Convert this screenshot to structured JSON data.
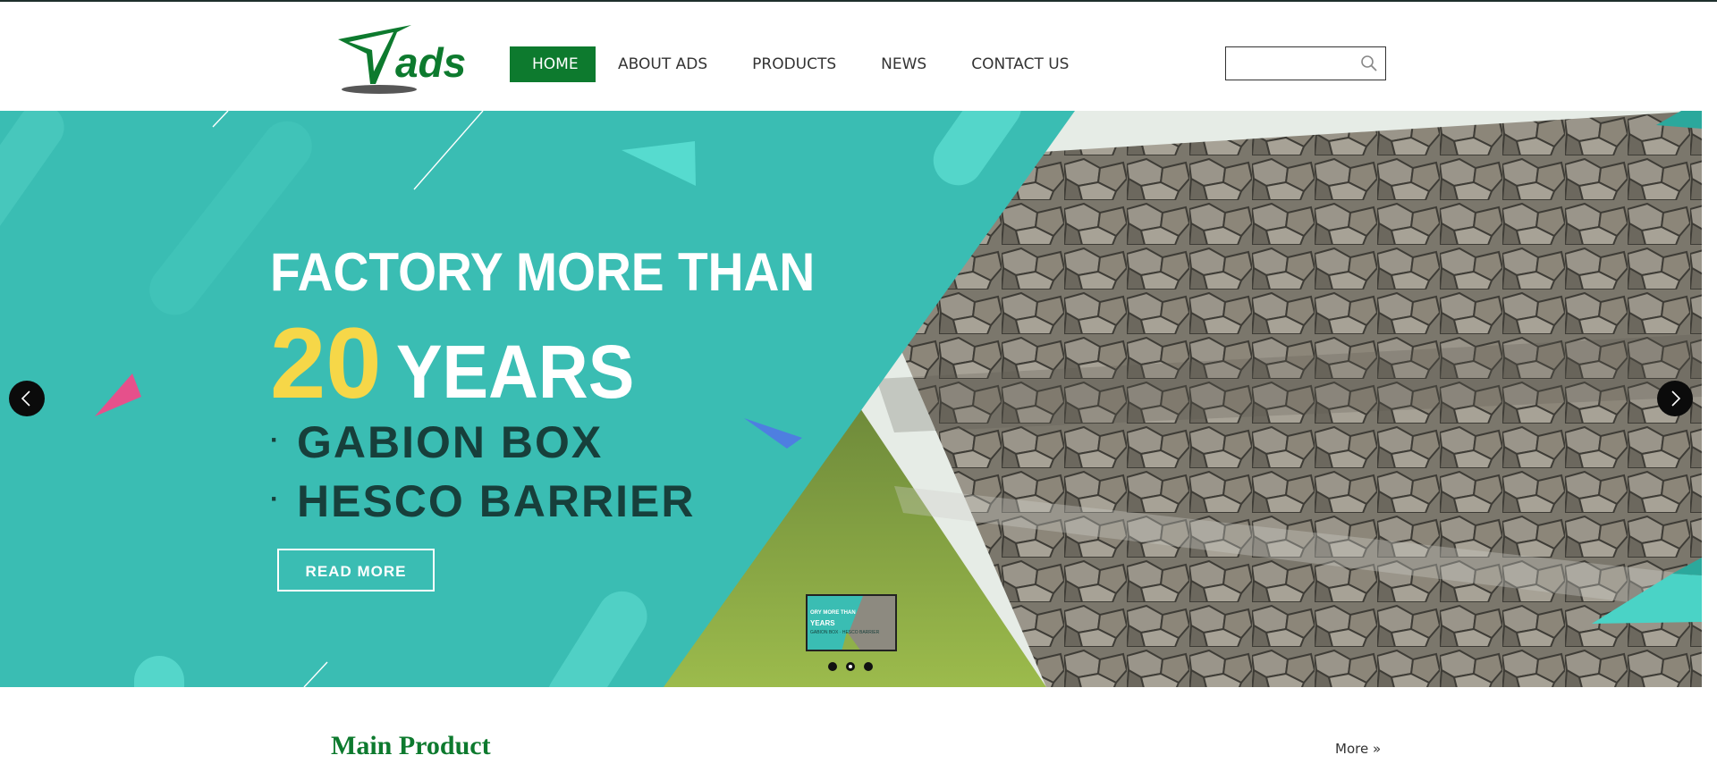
{
  "brand": {
    "logo_text": "ads",
    "logo_color": "#0d7a2e"
  },
  "nav": {
    "items": [
      {
        "label": "HOME",
        "active": true
      },
      {
        "label": "ABOUT ADS",
        "active": false
      },
      {
        "label": "PRODUCTS",
        "active": false
      },
      {
        "label": "NEWS",
        "active": false
      },
      {
        "label": "CONTACT US",
        "active": false
      }
    ]
  },
  "search": {
    "value": "",
    "placeholder": "",
    "icon": "search-icon"
  },
  "banner": {
    "headline_line1": "FACTORY MORE THAN",
    "headline_number": "20",
    "headline_word": "YEARS",
    "bullets": [
      "GABION BOX",
      "HESCO BARRIER"
    ],
    "bullet_glyph": "·",
    "cta_label": "READ MORE",
    "prev_icon": "chevron-left-icon",
    "next_icon": "chevron-right-icon",
    "slide_count": 3,
    "active_slide": 2,
    "thumbnail": {
      "line1": "ORY MORE THAN",
      "line2": "YEARS",
      "line3": "GABION BOX · HESCO BARRIER"
    },
    "colors": {
      "teal": "#3abdb3",
      "accent_yellow": "#f6d748",
      "dark_text": "#173f3b"
    }
  },
  "main_product": {
    "title": "Main Product",
    "more_label": "More »"
  },
  "colors": {
    "brand_green": "#0d7a2e"
  }
}
